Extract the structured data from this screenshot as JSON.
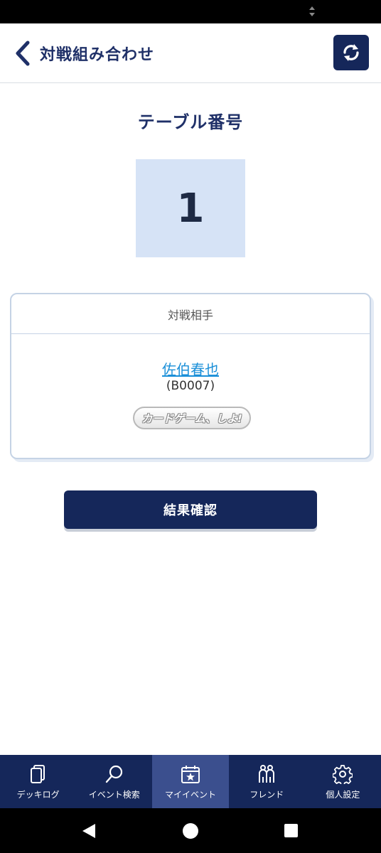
{
  "header": {
    "title": "対戦組み合わせ",
    "back_icon": "chevron-left-icon",
    "refresh_icon": "refresh-icon"
  },
  "table": {
    "label": "テーブル番号",
    "number": "1"
  },
  "opponent": {
    "heading": "対戦相手",
    "name": "佐伯春也",
    "id": "(B0007)",
    "tag": "カードゲーム、しよ!"
  },
  "actions": {
    "result_label": "結果確認"
  },
  "bottom_nav": {
    "items": [
      {
        "label": "デッキログ",
        "icon": "deck-icon"
      },
      {
        "label": "イベント検索",
        "icon": "search-icon"
      },
      {
        "label": "マイイベント",
        "icon": "calendar-star-icon"
      },
      {
        "label": "フレンド",
        "icon": "friends-icon"
      },
      {
        "label": "個人設定",
        "icon": "gear-icon"
      }
    ],
    "active_index": 2
  },
  "colors": {
    "navy": "#15275a",
    "title_blue": "#1f3068",
    "link_blue": "#1a8fd8",
    "number_box": "#d6e3f6",
    "active_nav": "#3b4f8e"
  }
}
